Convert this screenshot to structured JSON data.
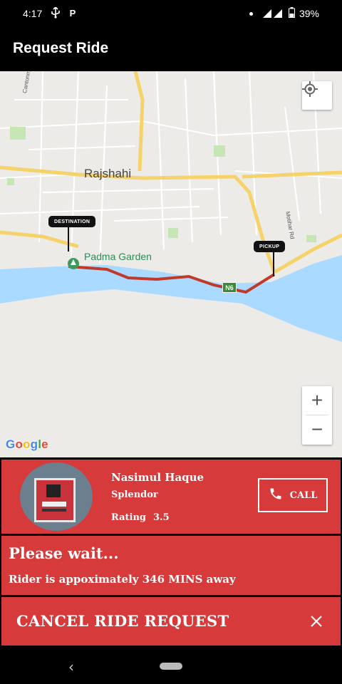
{
  "status_bar": {
    "time": "4:17",
    "battery": "39%",
    "icons": [
      "usb-icon",
      "parking-icon",
      "dot-icon",
      "signal-icon",
      "battery-icon"
    ]
  },
  "app_bar": {
    "title": "Request Ride"
  },
  "map": {
    "city_label": "Rajshahi",
    "poi_label": "Padma Garden",
    "road_labels": [
      "Cantonment Rd",
      "Motihar Rd"
    ],
    "road_shield": "N6",
    "destination_tag": "DESTINATION",
    "pickup_tag": "PICKUP",
    "zoom_in": "+",
    "zoom_out": "−",
    "logo": "Google",
    "route_color": "#c0392b"
  },
  "driver": {
    "name": "Nasimul Haque",
    "vehicle": "Splendor",
    "rating_label": "Rating",
    "rating_value": "3.5",
    "call_label": "CALL"
  },
  "status": {
    "title": "Please wait...",
    "message": "Rider is appoximately 346 MINS away"
  },
  "cancel": {
    "label": "CANCEL RIDE REQUEST"
  },
  "colors": {
    "panel_red": "#d63a3a",
    "app_bar": "#000000"
  }
}
